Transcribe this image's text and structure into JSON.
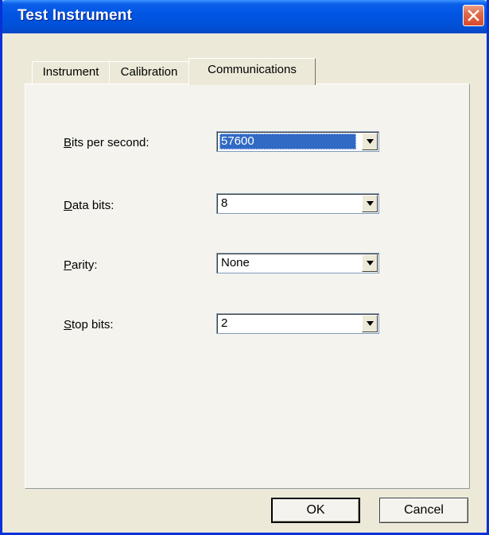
{
  "window": {
    "title": "Test Instrument"
  },
  "tabs": [
    {
      "label": "Instrument",
      "active": false
    },
    {
      "label": "Calibration",
      "active": false
    },
    {
      "label": "Communications",
      "active": true
    }
  ],
  "fields": {
    "bits_per_second": {
      "label_acc": "B",
      "label_rest": "its per second:",
      "value": "57600"
    },
    "data_bits": {
      "label_acc": "D",
      "label_rest": "ata bits:",
      "value": "8"
    },
    "parity": {
      "label_acc": "P",
      "label_rest": "arity:",
      "value": "None"
    },
    "stop_bits": {
      "label_acc": "S",
      "label_rest": "top bits:",
      "value": "2"
    }
  },
  "buttons": {
    "ok": "OK",
    "cancel": "Cancel"
  },
  "icons": {
    "close": "close-icon",
    "dropdown": "chevron-down-icon"
  },
  "colors": {
    "titlebar": "#0054e3",
    "selection": "#316ac5",
    "close": "#e06a4c",
    "face": "#ece9d8"
  }
}
